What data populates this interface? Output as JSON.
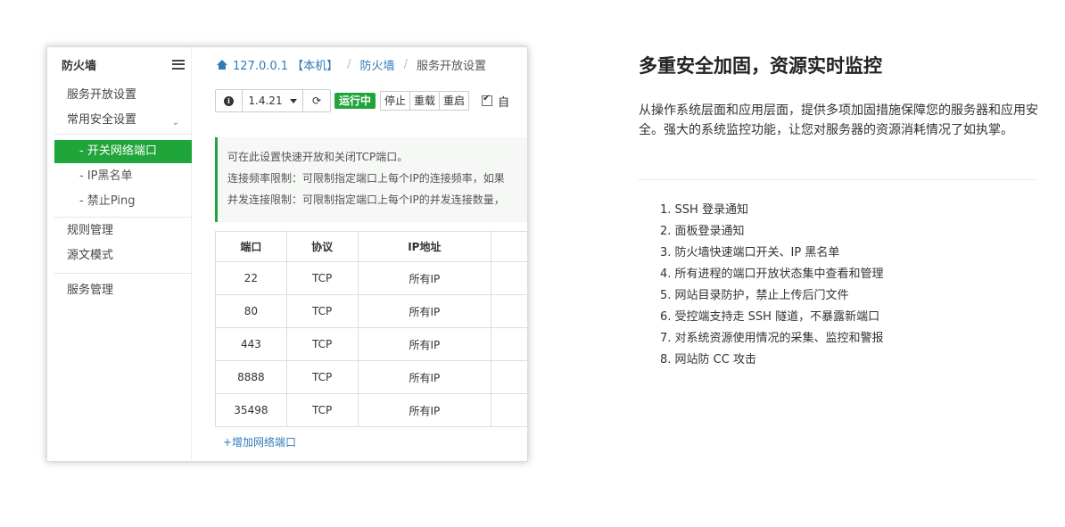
{
  "sidebar": {
    "title": "防火墙",
    "items": [
      {
        "label": "服务开放设置"
      },
      {
        "label": "常用安全设置"
      },
      {
        "label": "- 开关网络端口"
      },
      {
        "label": "- IP黑名单"
      },
      {
        "label": "- 禁止Ping"
      },
      {
        "label": "规则管理"
      },
      {
        "label": "源文模式"
      },
      {
        "label": "服务管理"
      }
    ]
  },
  "breadcrumb": {
    "host": "127.0.0.1 【本机】",
    "section": "防火墙",
    "page": "服务开放设置"
  },
  "toolbar": {
    "version": "1.4.21",
    "status": "运行中",
    "stop": "停止",
    "reload": "重载",
    "restart": "重启",
    "auto_label": "自"
  },
  "notice": {
    "line1": "可在此设置快速开放和关闭TCP端口。",
    "line2": "连接频率限制：可限制指定端口上每个IP的连接频率，如果",
    "line3": "并发连接限制：可限制指定端口上每个IP的并发连接数量，"
  },
  "table": {
    "headers": [
      "端口",
      "协议",
      "IP地址",
      ""
    ],
    "rows": [
      {
        "port": "22",
        "protocol": "TCP",
        "ip": "所有IP"
      },
      {
        "port": "80",
        "protocol": "TCP",
        "ip": "所有IP"
      },
      {
        "port": "443",
        "protocol": "TCP",
        "ip": "所有IP"
      },
      {
        "port": "8888",
        "protocol": "TCP",
        "ip": "所有IP"
      },
      {
        "port": "35498",
        "protocol": "TCP",
        "ip": "所有IP"
      }
    ],
    "add_link": "+增加网络端口"
  },
  "feature": {
    "heading": "多重安全加固，资源实时监控",
    "description": "从操作系统层面和应用层面，提供多项加固措施保障您的服务器和应用安全。强大的系统监控功能，让您对服务器的资源消耗情况了如执掌。",
    "list": [
      "1. SSH 登录通知",
      "2. 面板登录通知",
      "3. 防火墙快速端口开关、IP 黑名单",
      "4. 所有进程的端口开放状态集中查看和管理",
      "5. 网站目录防护，禁止上传后门文件",
      "6. 受控端支持走 SSH 隧道，不暴露新端口",
      "7. 对系统资源使用情况的采集、监控和警报",
      "8. 网站防 CC 攻击"
    ]
  },
  "colors": {
    "accent_green": "#20a53a",
    "link_blue": "#2f7ab9"
  }
}
